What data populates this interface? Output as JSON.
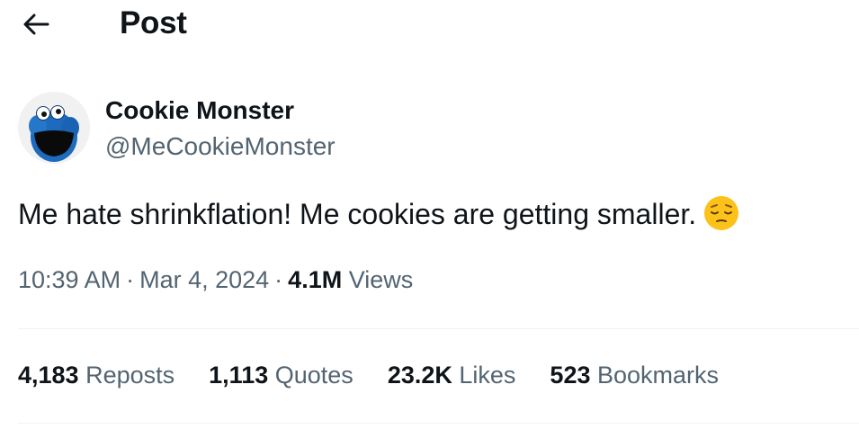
{
  "header": {
    "back_icon": "arrow-left-icon",
    "title": "Post"
  },
  "author": {
    "display_name": "Cookie Monster",
    "handle": "@MeCookieMonster",
    "avatar_icon": "cookie-monster-avatar"
  },
  "tweet": {
    "text": "Me hate shrinkflation! Me cookies are getting smaller.",
    "emoji": "pensive-face-emoji"
  },
  "meta": {
    "time": "10:39 AM",
    "separator": "·",
    "date": "Mar 4, 2024",
    "views_count": "4.1M",
    "views_label": "Views"
  },
  "stats": [
    {
      "count": "4,183",
      "label": "Reposts"
    },
    {
      "count": "1,113",
      "label": "Quotes"
    },
    {
      "count": "23.2K",
      "label": "Likes"
    },
    {
      "count": "523",
      "label": "Bookmarks"
    }
  ],
  "colors": {
    "text_primary": "#0f1419",
    "text_secondary": "#536471",
    "divider": "#eff3f4",
    "avatar_blue": "#1c6bbf",
    "emoji_yellow": "#fcc21b"
  }
}
